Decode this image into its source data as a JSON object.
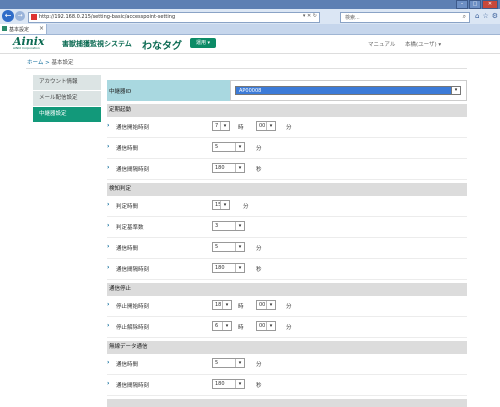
{
  "browser": {
    "url": "http://192.168.0.215/setting-basic/accesspoint-setting",
    "search_placeholder": "検索...",
    "tab_title": "基本設定"
  },
  "header": {
    "logo": "Ainix",
    "logo_sub": "AINIX Corporation",
    "system_name": "害獣捕獲監視システム",
    "product": "わなタグ",
    "use_button": "運用",
    "manual": "マニュアル",
    "user": "本橋(ユーザ)"
  },
  "breadcrumb": {
    "home": "ホーム",
    "sep": ">",
    "current": "基本設定"
  },
  "sidebar": {
    "items": [
      {
        "label": "アカウント情報"
      },
      {
        "label": "メール配信設定"
      },
      {
        "label": "中継器設定"
      }
    ]
  },
  "main": {
    "relay_id_label": "中継器ID",
    "relay_id_value": "AP00008",
    "sections": {
      "periodic": {
        "title": "定期起動",
        "rows": [
          {
            "label": "通信開始時刻",
            "v1": "7",
            "u1": "時",
            "v2": "00",
            "u2": "分"
          },
          {
            "label": "通信時間",
            "v1": "5",
            "u1": "分"
          },
          {
            "label": "通信間隔時刻",
            "v1": "180",
            "u1": "秒"
          }
        ]
      },
      "detect": {
        "title": "検知判定",
        "rows": [
          {
            "label": "判定時間",
            "v1": "15",
            "u1": "分"
          },
          {
            "label": "判定基準数",
            "v1": "3"
          },
          {
            "label": "通信時間",
            "v1": "5",
            "u1": "分"
          },
          {
            "label": "通信間隔時刻",
            "v1": "180",
            "u1": "秒"
          }
        ]
      },
      "stop": {
        "title": "通信停止",
        "rows": [
          {
            "label": "停止開始時刻",
            "v1": "18",
            "u1": "時",
            "v2": "00",
            "u2": "分"
          },
          {
            "label": "停止解除時刻",
            "v1": "6",
            "u1": "時",
            "v2": "00",
            "u2": "分"
          }
        ]
      },
      "sensor": {
        "title": "無線データ通信",
        "rows": [
          {
            "label": "通信時間",
            "v1": "5",
            "u1": "分"
          },
          {
            "label": "通信間隔時刻",
            "v1": "180",
            "u1": "秒"
          }
        ]
      }
    }
  },
  "colors": {
    "brand": "#0b6a52",
    "accent": "#12997a",
    "highlight_row": "#a9d8e0"
  }
}
